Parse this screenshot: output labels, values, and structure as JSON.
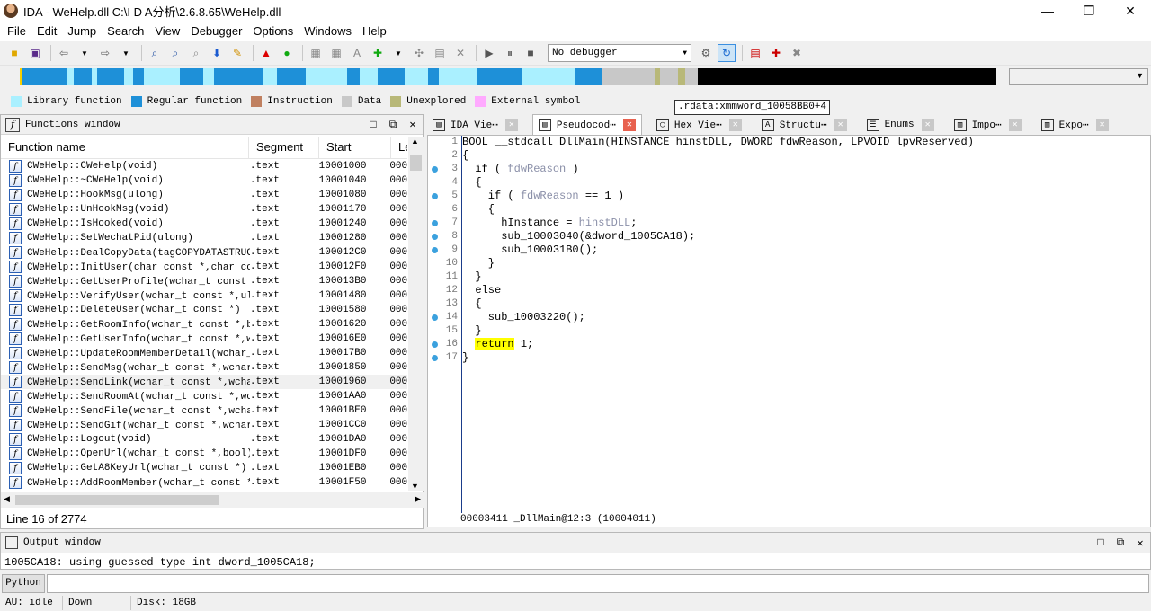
{
  "window": {
    "title": "IDA - WeHelp.dll C:\\I D A分析\\2.6.8.65\\WeHelp.dll",
    "minimize": "—",
    "maximize": "❐",
    "close": "✕"
  },
  "menu": [
    "File",
    "Edit",
    "Jump",
    "Search",
    "View",
    "Debugger",
    "Options",
    "Windows",
    "Help"
  ],
  "toolbar": {
    "debugger": "No debugger"
  },
  "legend": [
    {
      "label": "Library function",
      "color": "#aaf0ff"
    },
    {
      "label": "Regular function",
      "color": "#1e90d8"
    },
    {
      "label": "Instruction",
      "color": "#c08060"
    },
    {
      "label": "Data",
      "color": "#c8c8c8"
    },
    {
      "label": "Unexplored",
      "color": "#b8b878"
    },
    {
      "label": "External symbol",
      "color": "#ffaaff"
    }
  ],
  "tooltip": ".rdata:xmmword_10058BB0+4",
  "functions_window": {
    "title": "Functions window",
    "columns": [
      "Function name",
      "Segment",
      "Start",
      "Le"
    ],
    "rows": [
      {
        "name": "CWeHelp::CWeHelp(void)",
        "seg": ".text",
        "start": "10001000",
        "len": "000"
      },
      {
        "name": "CWeHelp::~CWeHelp(void)",
        "seg": ".text",
        "start": "10001040",
        "len": "000"
      },
      {
        "name": "CWeHelp::HookMsg(ulong)",
        "seg": ".text",
        "start": "10001080",
        "len": "000"
      },
      {
        "name": "CWeHelp::UnHookMsg(void)",
        "seg": ".text",
        "start": "10001170",
        "len": "000"
      },
      {
        "name": "CWeHelp::IsHooked(void)",
        "seg": ".text",
        "start": "10001240",
        "len": "000"
      },
      {
        "name": "CWeHelp::SetWechatPid(ulong)",
        "seg": ".text",
        "start": "10001280",
        "len": "000"
      },
      {
        "name": "CWeHelp::DealCopyData(tagCOPYDATASTRUC⋯",
        "seg": ".text",
        "start": "100012C0",
        "len": "000"
      },
      {
        "name": "CWeHelp::InitUser(char const *,char co⋯",
        "seg": ".text",
        "start": "100012F0",
        "len": "000"
      },
      {
        "name": "CWeHelp::GetUserProfile(wchar_t const ⋯",
        "seg": ".text",
        "start": "100013B0",
        "len": "000"
      },
      {
        "name": "CWeHelp::VerifyUser(wchar_t const *,ul⋯",
        "seg": ".text",
        "start": "10001480",
        "len": "000"
      },
      {
        "name": "CWeHelp::DeleteUser(wchar_t const *)",
        "seg": ".text",
        "start": "10001580",
        "len": "000"
      },
      {
        "name": "CWeHelp::GetRoomInfo(wchar_t const *,b⋯",
        "seg": ".text",
        "start": "10001620",
        "len": "000"
      },
      {
        "name": "CWeHelp::GetUserInfo(wchar_t const *,w⋯",
        "seg": ".text",
        "start": "100016E0",
        "len": "000"
      },
      {
        "name": "CWeHelp::UpdateRoomMemberDetail(wchar_⋯",
        "seg": ".text",
        "start": "100017B0",
        "len": "000"
      },
      {
        "name": "CWeHelp::SendMsg(wchar_t const *,wchar⋯",
        "seg": ".text",
        "start": "10001850",
        "len": "000"
      },
      {
        "name": "CWeHelp::SendLink(wchar_t const *,wcha⋯",
        "seg": ".text",
        "start": "10001960",
        "len": "000",
        "selected": true
      },
      {
        "name": "CWeHelp::SendRoomAt(wchar_t const *,wc⋯",
        "seg": ".text",
        "start": "10001AA0",
        "len": "000"
      },
      {
        "name": "CWeHelp::SendFile(wchar_t const *,wcha⋯",
        "seg": ".text",
        "start": "10001BE0",
        "len": "000"
      },
      {
        "name": "CWeHelp::SendGif(wchar_t const *,wchar⋯",
        "seg": ".text",
        "start": "10001CC0",
        "len": "000"
      },
      {
        "name": "CWeHelp::Logout(void)",
        "seg": ".text",
        "start": "10001DA0",
        "len": "000"
      },
      {
        "name": "CWeHelp::OpenUrl(wchar_t const *,bool)",
        "seg": ".text",
        "start": "10001DF0",
        "len": "000"
      },
      {
        "name": "CWeHelp::GetA8KeyUrl(wchar_t const *)",
        "seg": ".text",
        "start": "10001EB0",
        "len": "000"
      },
      {
        "name": "CWeHelp::AddRoomMember(wchar_t const *⋯",
        "seg": ".text",
        "start": "10001F50",
        "len": "000"
      }
    ],
    "status": "Line 16 of 2774"
  },
  "tabs": [
    {
      "label": "IDA Vie⋯",
      "icon": "▤"
    },
    {
      "label": "Pseudocod⋯",
      "icon": "▤",
      "active": true
    },
    {
      "label": "Hex Vie⋯",
      "icon": "◯"
    },
    {
      "label": "Structu⋯",
      "icon": "A"
    },
    {
      "label": "Enums",
      "icon": "☰"
    },
    {
      "label": "Impo⋯",
      "icon": "▥"
    },
    {
      "label": "Expo⋯",
      "icon": "▥"
    }
  ],
  "code": {
    "lines": [
      {
        "n": "1",
        "dot": false,
        "text": "BOOL __stdcall DllMain(HINSTANCE hinstDLL, DWORD fdwReason, LPVOID lpvReserved)"
      },
      {
        "n": "2",
        "dot": false,
        "text": "{"
      },
      {
        "n": "3",
        "dot": true,
        "parts": [
          [
            "  if ( ",
            ""
          ],
          [
            "fdwReason",
            "gr"
          ],
          [
            " )",
            ""
          ]
        ]
      },
      {
        "n": "4",
        "dot": false,
        "text": "  {"
      },
      {
        "n": "5",
        "dot": true,
        "parts": [
          [
            "    if ( ",
            ""
          ],
          [
            "fdwReason",
            "gr"
          ],
          [
            " == 1 )",
            ""
          ]
        ]
      },
      {
        "n": "6",
        "dot": false,
        "text": "    {"
      },
      {
        "n": "7",
        "dot": true,
        "parts": [
          [
            "      hInstance = ",
            ""
          ],
          [
            "hinstDLL",
            "gr"
          ],
          [
            ";",
            ""
          ]
        ]
      },
      {
        "n": "8",
        "dot": true,
        "text": "      sub_10003040(&dword_1005CA18);"
      },
      {
        "n": "9",
        "dot": true,
        "text": "      sub_100031B0();"
      },
      {
        "n": "10",
        "dot": false,
        "text": "    }"
      },
      {
        "n": "11",
        "dot": false,
        "text": "  }"
      },
      {
        "n": "12",
        "dot": false,
        "text": "  else"
      },
      {
        "n": "13",
        "dot": false,
        "text": "  {"
      },
      {
        "n": "14",
        "dot": true,
        "text": "    sub_10003220();"
      },
      {
        "n": "15",
        "dot": false,
        "text": "  }"
      },
      {
        "n": "16",
        "dot": true,
        "parts": [
          [
            "  ",
            ""
          ],
          [
            "return",
            "hl"
          ],
          [
            " 1;",
            ""
          ]
        ]
      },
      {
        "n": "17",
        "dot": true,
        "text": "}"
      }
    ],
    "status": "00003411 _DllMain@12:3 (10004011)"
  },
  "output": {
    "title": "Output window",
    "text": "1005CA18: using guessed type int dword_1005CA18;"
  },
  "python": {
    "label": "Python"
  },
  "statusbar": {
    "au": "AU:  idle",
    "dir": "Down",
    "disk": "Disk: 18GB"
  }
}
